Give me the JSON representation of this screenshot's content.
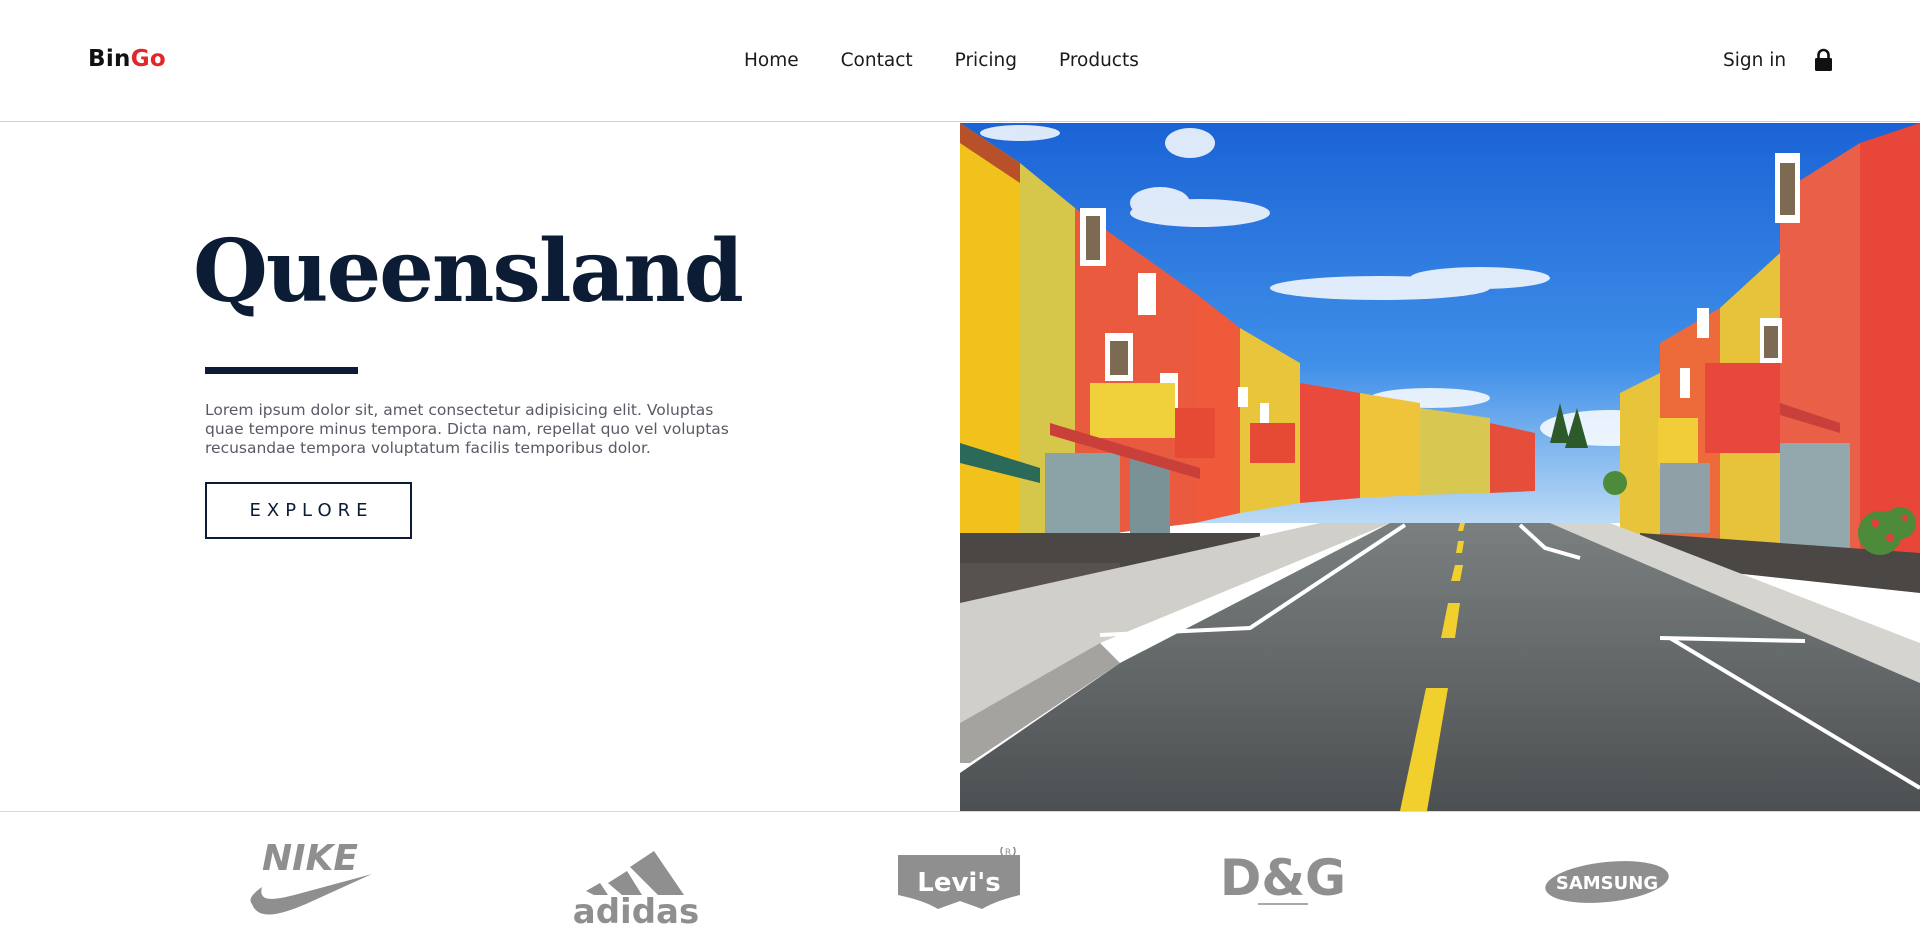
{
  "header": {
    "logo_part1": "Bin",
    "logo_part2": "Go",
    "nav": [
      "Home",
      "Contact",
      "Pricing",
      "Products"
    ],
    "signin_label": "Sign in",
    "lock_icon": "lock-icon"
  },
  "hero": {
    "title": "Queensland",
    "text": "Lorem ipsum dolor sit, amet consectetur adipisicing elit. Voluptas quae tempore minus tempora. Dicta nam, repellat quo vel voluptas recusandae tempora voluptatum facilis temporibus dolor.",
    "button_label": "EXPLORE",
    "image": "colorful-houses-street-photo"
  },
  "brands": [
    "NIKE",
    "adidas",
    "Levi's",
    "D&G",
    "SAMSUNG"
  ],
  "colors": {
    "navy": "#0d1c35",
    "logo_red": "#e1262c",
    "brand_gray": "#8f8f8f"
  }
}
